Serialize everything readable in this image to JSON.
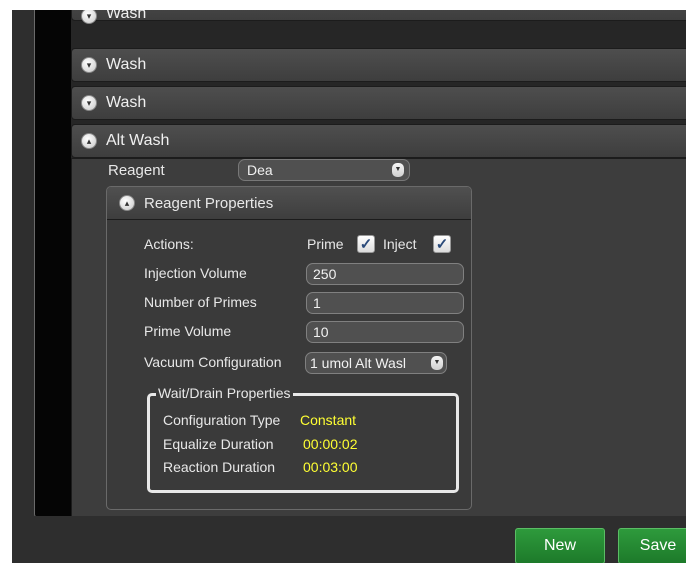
{
  "accordion": {
    "sections": [
      {
        "label": "Wash",
        "expanded": false
      },
      {
        "label": "Wash",
        "expanded": false
      },
      {
        "label": "Wash",
        "expanded": false
      },
      {
        "label": "Alt Wash",
        "expanded": true
      }
    ]
  },
  "reagent": {
    "label": "Reagent",
    "value": "Dea"
  },
  "reagent_properties": {
    "title": "Reagent Properties",
    "actions_label": "Actions:",
    "prime_label": "Prime",
    "prime_checked": true,
    "inject_label": "Inject",
    "inject_checked": true,
    "injection_volume_label": "Injection Volume",
    "injection_volume": "250",
    "num_primes_label": "Number of Primes",
    "num_primes": "1",
    "prime_volume_label": "Prime Volume",
    "prime_volume": "10",
    "vacuum_label": "Vacuum Configuration",
    "vacuum_value": "1 umol Alt Wasl"
  },
  "wait_drain": {
    "title": "Wait/Drain Properties",
    "config_type_label": "Configuration Type",
    "config_type": "Constant",
    "equalize_label": "Equalize Duration",
    "equalize": "00:00:02",
    "reaction_label": "Reaction Duration",
    "reaction": "00:03:00"
  },
  "buttons": {
    "new": "New",
    "save": "Save"
  },
  "colors": {
    "accent_green": "#2e9a3c",
    "value_yellow": "#ffff33"
  }
}
